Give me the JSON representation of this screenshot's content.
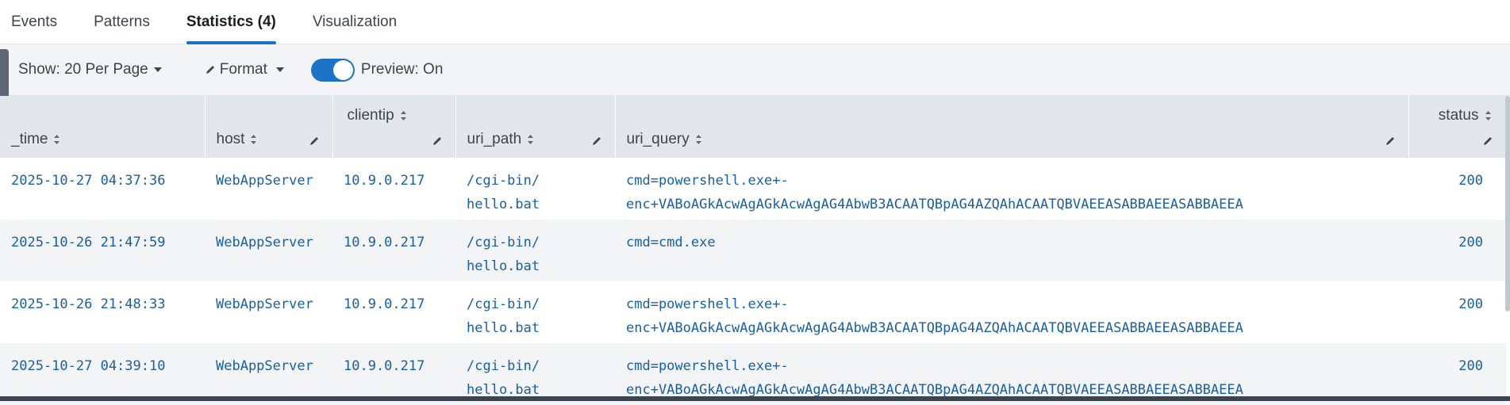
{
  "tabs": [
    {
      "label": "Events"
    },
    {
      "label": "Patterns"
    },
    {
      "label": "Statistics (4)"
    },
    {
      "label": "Visualization"
    }
  ],
  "toolbar": {
    "show_label": "Show: 20 Per Page",
    "format_label": "Format",
    "preview_label": "Preview: On"
  },
  "table": {
    "headers": [
      "_time",
      "host",
      "clientip",
      "uri_path",
      "uri_query",
      "status"
    ],
    "rows": [
      [
        "2025-10-27 04:37:36",
        "WebAppServer",
        "10.9.0.217",
        "/cgi-bin/\nhello.bat",
        "cmd=powershell.exe+-\nenc+VABoAGkAcwAgAGkAcwAgAG4AbwB3ACAATQBpAG4AZQAhACAATQBVAEEASABBAEEASABBAEEA",
        "200"
      ],
      [
        "2025-10-26 21:47:59",
        "WebAppServer",
        "10.9.0.217",
        "/cgi-bin/\nhello.bat",
        "cmd=cmd.exe",
        "200"
      ],
      [
        "2025-10-26 21:48:33",
        "WebAppServer",
        "10.9.0.217",
        "/cgi-bin/\nhello.bat",
        "cmd=powershell.exe+-\nenc+VABoAGkAcwAgAGkAcwAgAG4AbwB3ACAATQBpAG4AZQAhACAATQBVAEEASABBAEEASABBAEEA",
        "200"
      ],
      [
        "2025-10-27 04:39:10",
        "WebAppServer",
        "10.9.0.217",
        "/cgi-bin/\nhello.bat",
        "cmd=powershell.exe+-\nenc+VABoAGkAcwAgAGkAcwAgAG4AbwB3ACAATQBpAG4AZQAhACAATQBVAEEASABBAEEASABBAEEA",
        "200"
      ]
    ]
  },
  "colors": {
    "accent": "#1a73c6",
    "link_text": "#1a5fa3",
    "header_bg": "#e3e7eb"
  }
}
